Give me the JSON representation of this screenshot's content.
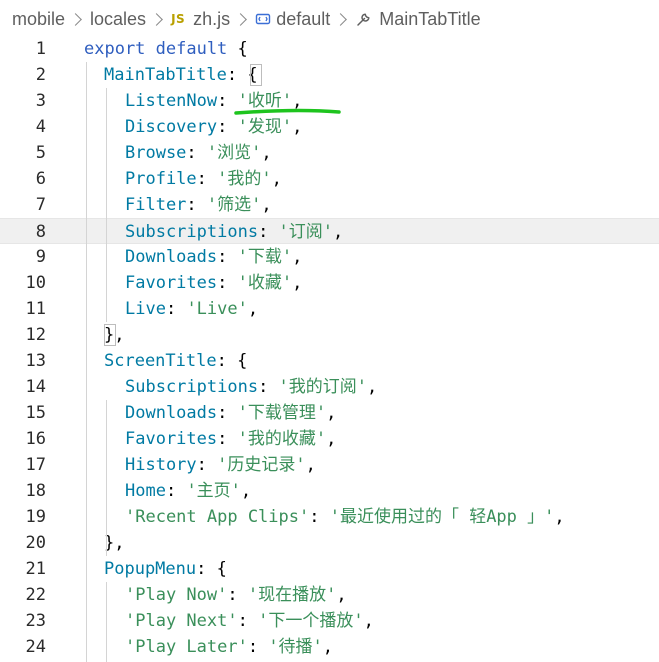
{
  "breadcrumb": {
    "items": [
      "mobile",
      "locales",
      "zh.js",
      "default",
      "MainTabTitle"
    ],
    "file_badge": "JS",
    "icons": [
      "chevron-right-icon",
      "js-file-icon",
      "symbol-variable-icon",
      "wrench-property-icon"
    ]
  },
  "editor": {
    "current_line": 8,
    "lines": [
      {
        "n": "1",
        "parts": [
          {
            "t": "export default",
            "c": "kw"
          },
          {
            "t": " {",
            "c": "pun"
          }
        ]
      },
      {
        "n": "2",
        "parts": [
          {
            "t": "MainTabTitle",
            "c": "key"
          },
          {
            "t": ": ",
            "c": "pun"
          },
          {
            "t": "{",
            "c": "pun"
          }
        ]
      },
      {
        "n": "3",
        "parts": [
          {
            "t": "ListenNow",
            "c": "key"
          },
          {
            "t": ": ",
            "c": "pun"
          },
          {
            "t": "'收听'",
            "c": "str"
          },
          {
            "t": ",",
            "c": "pun"
          }
        ]
      },
      {
        "n": "4",
        "parts": [
          {
            "t": "Discovery",
            "c": "key"
          },
          {
            "t": ": ",
            "c": "pun"
          },
          {
            "t": "'发现'",
            "c": "str"
          },
          {
            "t": ",",
            "c": "pun"
          }
        ]
      },
      {
        "n": "5",
        "parts": [
          {
            "t": "Browse",
            "c": "key"
          },
          {
            "t": ": ",
            "c": "pun"
          },
          {
            "t": "'浏览'",
            "c": "str"
          },
          {
            "t": ",",
            "c": "pun"
          }
        ]
      },
      {
        "n": "6",
        "parts": [
          {
            "t": "Profile",
            "c": "key"
          },
          {
            "t": ": ",
            "c": "pun"
          },
          {
            "t": "'我的'",
            "c": "str"
          },
          {
            "t": ",",
            "c": "pun"
          }
        ]
      },
      {
        "n": "7",
        "parts": [
          {
            "t": "Filter",
            "c": "key"
          },
          {
            "t": ": ",
            "c": "pun"
          },
          {
            "t": "'筛选'",
            "c": "str"
          },
          {
            "t": ",",
            "c": "pun"
          }
        ]
      },
      {
        "n": "8",
        "parts": [
          {
            "t": "Subscriptions",
            "c": "key"
          },
          {
            "t": ": ",
            "c": "pun"
          },
          {
            "t": "'订阅'",
            "c": "str"
          },
          {
            "t": ",",
            "c": "pun"
          }
        ]
      },
      {
        "n": "9",
        "parts": [
          {
            "t": "Downloads",
            "c": "key"
          },
          {
            "t": ": ",
            "c": "pun"
          },
          {
            "t": "'下载'",
            "c": "str"
          },
          {
            "t": ",",
            "c": "pun"
          }
        ]
      },
      {
        "n": "10",
        "parts": [
          {
            "t": "Favorites",
            "c": "key"
          },
          {
            "t": ": ",
            "c": "pun"
          },
          {
            "t": "'收藏'",
            "c": "str"
          },
          {
            "t": ",",
            "c": "pun"
          }
        ]
      },
      {
        "n": "11",
        "parts": [
          {
            "t": "Live",
            "c": "key"
          },
          {
            "t": ": ",
            "c": "pun"
          },
          {
            "t": "'Live'",
            "c": "str"
          },
          {
            "t": ",",
            "c": "pun"
          }
        ]
      },
      {
        "n": "12",
        "parts": [
          {
            "t": "}",
            "c": "pun"
          },
          {
            "t": ",",
            "c": "pun"
          }
        ]
      },
      {
        "n": "13",
        "parts": [
          {
            "t": "ScreenTitle",
            "c": "key"
          },
          {
            "t": ": ",
            "c": "pun"
          },
          {
            "t": "{",
            "c": "pun"
          }
        ]
      },
      {
        "n": "14",
        "parts": [
          {
            "t": "Subscriptions",
            "c": "key"
          },
          {
            "t": ": ",
            "c": "pun"
          },
          {
            "t": "'我的订阅'",
            "c": "str"
          },
          {
            "t": ",",
            "c": "pun"
          }
        ]
      },
      {
        "n": "15",
        "parts": [
          {
            "t": "Downloads",
            "c": "key"
          },
          {
            "t": ": ",
            "c": "pun"
          },
          {
            "t": "'下载管理'",
            "c": "str"
          },
          {
            "t": ",",
            "c": "pun"
          }
        ]
      },
      {
        "n": "16",
        "parts": [
          {
            "t": "Favorites",
            "c": "key"
          },
          {
            "t": ": ",
            "c": "pun"
          },
          {
            "t": "'我的收藏'",
            "c": "str"
          },
          {
            "t": ",",
            "c": "pun"
          }
        ]
      },
      {
        "n": "17",
        "parts": [
          {
            "t": "History",
            "c": "key"
          },
          {
            "t": ": ",
            "c": "pun"
          },
          {
            "t": "'历史记录'",
            "c": "str"
          },
          {
            "t": ",",
            "c": "pun"
          }
        ]
      },
      {
        "n": "18",
        "parts": [
          {
            "t": "Home",
            "c": "key"
          },
          {
            "t": ": ",
            "c": "pun"
          },
          {
            "t": "'主页'",
            "c": "str"
          },
          {
            "t": ",",
            "c": "pun"
          }
        ]
      },
      {
        "n": "19",
        "parts": [
          {
            "t": "'Recent App Clips'",
            "c": "str"
          },
          {
            "t": ": ",
            "c": "pun"
          },
          {
            "t": "'最近使用过的「 轻App 」'",
            "c": "str"
          },
          {
            "t": ",",
            "c": "pun"
          }
        ]
      },
      {
        "n": "20",
        "parts": [
          {
            "t": "}",
            "c": "pun"
          },
          {
            "t": ",",
            "c": "pun"
          }
        ]
      },
      {
        "n": "21",
        "parts": [
          {
            "t": "PopupMenu",
            "c": "key"
          },
          {
            "t": ": ",
            "c": "pun"
          },
          {
            "t": "{",
            "c": "pun"
          }
        ]
      },
      {
        "n": "22",
        "parts": [
          {
            "t": "'Play Now'",
            "c": "str"
          },
          {
            "t": ": ",
            "c": "pun"
          },
          {
            "t": "'现在播放'",
            "c": "str"
          },
          {
            "t": ",",
            "c": "pun"
          }
        ]
      },
      {
        "n": "23",
        "parts": [
          {
            "t": "'Play Next'",
            "c": "str"
          },
          {
            "t": ": ",
            "c": "pun"
          },
          {
            "t": "'下一个播放'",
            "c": "str"
          },
          {
            "t": ",",
            "c": "pun"
          }
        ]
      },
      {
        "n": "24",
        "parts": [
          {
            "t": "'Play Later'",
            "c": "str"
          },
          {
            "t": ": ",
            "c": "pun"
          },
          {
            "t": "'待播'",
            "c": "str"
          },
          {
            "t": ",",
            "c": "pun"
          }
        ]
      }
    ]
  },
  "colors": {
    "keyword": "#2f5ebf",
    "property": "#007aa3",
    "string": "#3a8f5a",
    "annotation": "#1ec41e",
    "current_line_bg": "#f0f0f0"
  }
}
